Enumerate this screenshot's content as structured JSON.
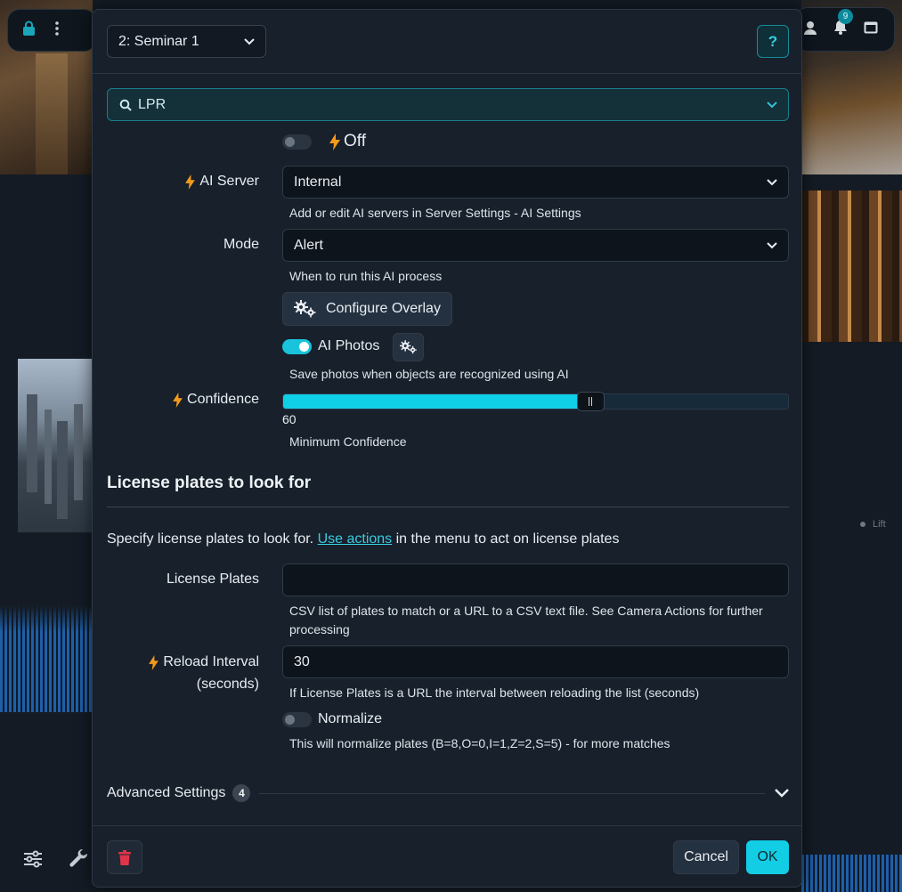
{
  "background": {
    "notifications_count": "9",
    "lift_label": "Lift"
  },
  "header": {
    "camera": "2: Seminar 1",
    "help_label": "?"
  },
  "section_select": {
    "value": "LPR"
  },
  "enable_toggle": {
    "state_label": "Off",
    "enabled": false
  },
  "ai_server": {
    "label": "AI Server",
    "value": "Internal",
    "help": "Add or edit AI servers in Server Settings - AI Settings"
  },
  "mode": {
    "label": "Mode",
    "value": "Alert",
    "help": "When to run this AI process"
  },
  "overlay": {
    "button_label": "Configure Overlay"
  },
  "ai_photos": {
    "label": "AI Photos",
    "enabled": true,
    "help": "Save photos when objects are recognized using AI"
  },
  "confidence": {
    "label": "Confidence",
    "value": 60,
    "value_text": "60",
    "help": "Minimum Confidence"
  },
  "plates_section": {
    "heading": "License plates to look for",
    "desc_before": "Specify license plates to look for. ",
    "desc_link": "Use actions",
    "desc_after": " in the menu to act on license plates"
  },
  "license_plates": {
    "label": "License Plates",
    "value": "",
    "help_line1": "CSV list of plates to match or a URL to a CSV text file. See Camera Actions for further",
    "help_line2": "processing"
  },
  "reload_interval": {
    "label_line1": "Reload Interval",
    "label_line2": "(seconds)",
    "value": "30",
    "help": "If License Plates is a URL the interval between reloading the list (seconds)"
  },
  "normalize": {
    "label": "Normalize",
    "enabled": false,
    "help": "This will normalize plates (B=8,O=0,I=1,Z=2,S=5) - for more matches"
  },
  "advanced": {
    "label": "Advanced Settings",
    "count": "4"
  },
  "footer": {
    "cancel_label": "Cancel",
    "ok_label": "OK"
  },
  "colors": {
    "accent": "#12cde4",
    "bolt": "#f59a1b",
    "danger": "#e0344a"
  }
}
